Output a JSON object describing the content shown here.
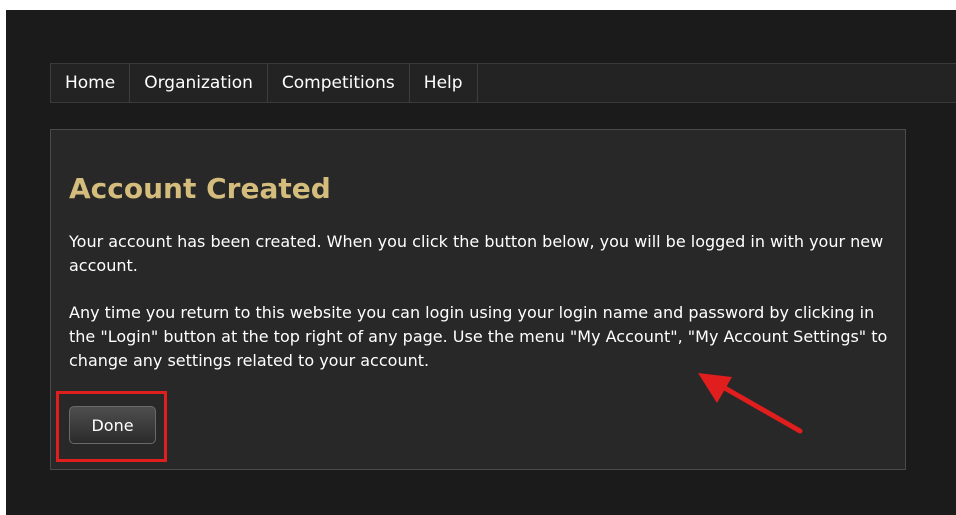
{
  "nav": {
    "items": [
      {
        "label": "Home"
      },
      {
        "label": "Organization"
      },
      {
        "label": "Competitions"
      },
      {
        "label": "Help"
      }
    ]
  },
  "panel": {
    "title": "Account Created",
    "paragraph1": "Your account has been created. When you click the button below, you will be logged in with your new account.",
    "paragraph2": "Any time you return to this website you can login using your login name and password by clicking in the \"Login\" button at the top right of any page. Use the menu \"My Account\", \"My Account Settings\" to change any settings related to your account.",
    "done_label": "Done"
  },
  "colors": {
    "background": "#1b1b1b",
    "panel": "#282828",
    "title": "#d4bc7c",
    "annotation": "#e01e1e"
  }
}
